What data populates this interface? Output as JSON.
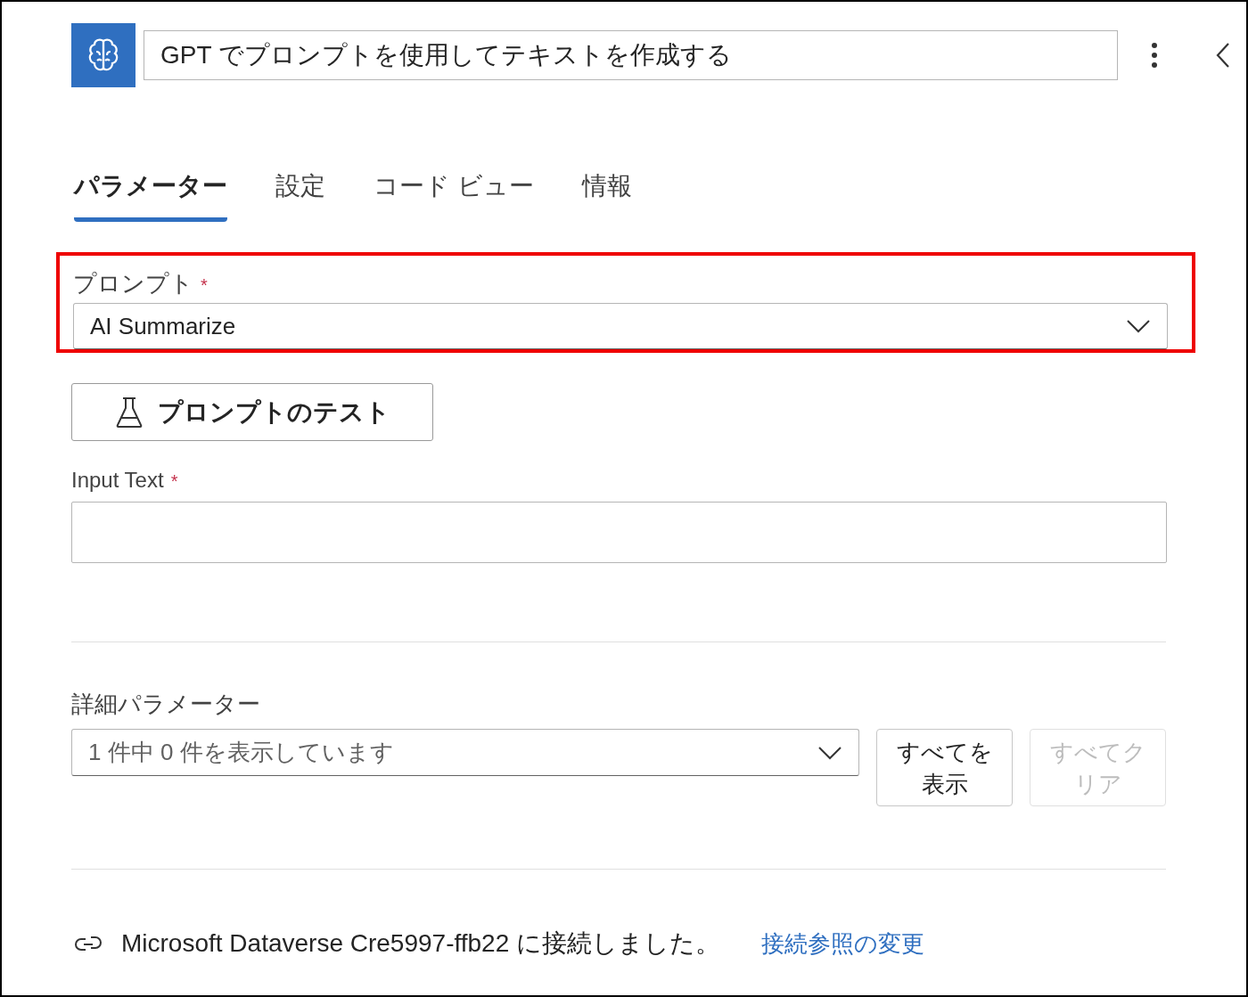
{
  "header": {
    "title": "GPT でプロンプトを使用してテキストを作成する"
  },
  "tabs": [
    {
      "label": "パラメーター",
      "selected": true
    },
    {
      "label": "設定",
      "selected": false
    },
    {
      "label": "コード ビュー",
      "selected": false
    },
    {
      "label": "情報",
      "selected": false
    }
  ],
  "prompt_field": {
    "label": "プロンプト",
    "required_mark": "*",
    "value": "AI Summarize",
    "highlighted": true
  },
  "test_button": {
    "label": "プロンプトのテスト"
  },
  "input_text": {
    "label": "Input Text",
    "required_mark": "*"
  },
  "advanced": {
    "label": "詳細パラメーター",
    "dropdown": "1 件中 0 件を表示しています",
    "buttons": [
      {
        "label": "すべてを表示",
        "disabled": false
      },
      {
        "label": "すべてクリア",
        "disabled": true
      }
    ]
  },
  "connection": {
    "text": "Microsoft Dataverse Cre5997-ffb22 に接続しました。",
    "link": "接続参照の変更"
  }
}
